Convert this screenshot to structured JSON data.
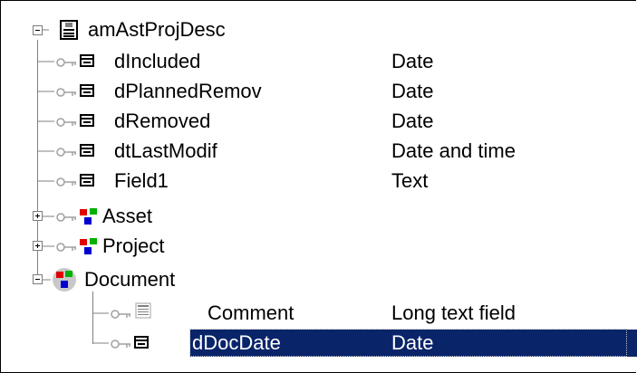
{
  "tree": {
    "root": {
      "label": "amAstProjDesc",
      "icon": "table-icon",
      "expanded": true
    },
    "fields": [
      {
        "name": "dIncluded",
        "type": "Date",
        "icon": "field-icon"
      },
      {
        "name": "dPlannedRemov",
        "type": "Date",
        "icon": "field-icon"
      },
      {
        "name": "dRemoved",
        "type": "Date",
        "icon": "field-icon"
      },
      {
        "name": "dtLastModif",
        "type": "Date and time",
        "icon": "field-icon"
      },
      {
        "name": "Field1",
        "type": "Text",
        "icon": "field-icon"
      }
    ],
    "links": [
      {
        "name": "Asset",
        "icon": "link-icon",
        "expanded": false
      },
      {
        "name": "Project",
        "icon": "link-icon",
        "expanded": false
      }
    ],
    "document": {
      "name": "Document",
      "icon": "link-dot-icon",
      "expanded": true,
      "children": [
        {
          "name": "Comment",
          "type": "Long text field",
          "icon": "memo-field-icon"
        },
        {
          "name": "dDocDate",
          "type": "Date",
          "icon": "field-icon",
          "selected": true
        }
      ]
    }
  },
  "colors": {
    "selection": "#0a246a",
    "connector": "#808080"
  }
}
